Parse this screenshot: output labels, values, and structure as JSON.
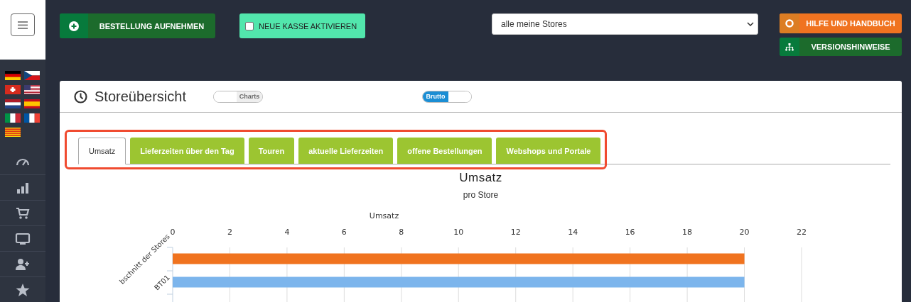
{
  "toolbar": {
    "order_button": "BESTELLUNG AUFNEHMEN",
    "register_toggle": {
      "label": "NEUE KASSE AKTIVIEREN",
      "checked": false
    },
    "store_select": {
      "value": "alle meine Stores"
    },
    "help_button": "HILFE UND HANDBUCH",
    "release_notes_button": "VERSIONSHINWEISE"
  },
  "panel": {
    "title": "Storeübersicht",
    "switches": [
      {
        "label": "Charts",
        "on": false
      },
      {
        "label": "Brutto",
        "on": true
      }
    ],
    "tabs": [
      {
        "label": "Umsatz",
        "selected": true
      },
      {
        "label": "Lieferzeiten über den Tag",
        "selected": false
      },
      {
        "label": "Touren",
        "selected": false
      },
      {
        "label": "aktuelle Lieferzeiten",
        "selected": false
      },
      {
        "label": "offene Bestellungen",
        "selected": false
      },
      {
        "label": "Webshops und Portale",
        "selected": false
      }
    ],
    "chart": {
      "subtitle": "pro Store",
      "chart_data": {
        "type": "bar",
        "orientation": "horizontal",
        "title": "Umsatz",
        "xlabel": "Umsatz",
        "categories": [
          "bschnitt der Stores",
          "BT01"
        ],
        "series": [
          {
            "colors": [
              "#f0731f",
              "#7cb5ec"
            ],
            "values": [
              20,
              20
            ]
          }
        ],
        "grid": true,
        "xlim": [
          0,
          22
        ],
        "xticks": [
          0,
          2,
          4,
          6,
          8,
          10,
          12,
          14,
          16,
          18,
          20,
          22
        ]
      }
    }
  }
}
